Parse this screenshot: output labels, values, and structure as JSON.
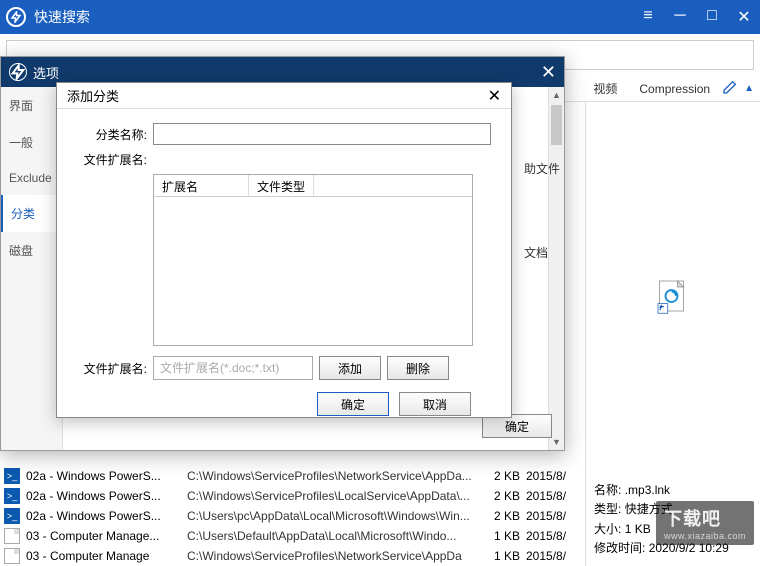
{
  "main": {
    "title": "快速搜索",
    "search_placeholder": "",
    "filetype_tabs": {
      "video": "视频",
      "compression": "Compression"
    },
    "confirm_btn": "确定"
  },
  "options_dialog": {
    "title": "选项",
    "nav": {
      "interface": "界面",
      "general": "一般",
      "exclude": "Exclude",
      "category": "分类",
      "disk": "磁盘"
    },
    "behind_fragments": {
      "help_file": "助文件",
      "doc": "文档"
    }
  },
  "add_category_modal": {
    "title": "添加分类",
    "name_label": "分类名称:",
    "ext_label": "文件扩展名:",
    "table": {
      "col_ext": "扩展名",
      "col_type": "文件类型"
    },
    "ext_input_label": "文件扩展名:",
    "ext_input_placeholder": "文件扩展名(*.doc;*.txt)",
    "add_btn": "添加",
    "delete_btn": "删除",
    "ok_btn": "确定",
    "cancel_btn": "取消"
  },
  "preview": {
    "name_label": "名称:",
    "name_value": ".mp3.lnk",
    "type_label": "类型:",
    "type_value": "快捷方式",
    "size_label": "大小:",
    "size_value": "1 KB",
    "mtime_label": "修改时间:",
    "mtime_value": "2020/9/2 10:29"
  },
  "files": [
    {
      "icon": "ps",
      "name": "02a - Windows PowerS...",
      "path": "C:\\Windows\\ServiceProfiles\\NetworkService\\AppDa...",
      "size": "2 KB",
      "date": "2015/8/"
    },
    {
      "icon": "ps",
      "name": "02a - Windows PowerS...",
      "path": "C:\\Windows\\ServiceProfiles\\LocalService\\AppData\\...",
      "size": "2 KB",
      "date": "2015/8/"
    },
    {
      "icon": "ps",
      "name": "02a - Windows PowerS...",
      "path": "C:\\Users\\pc\\AppData\\Local\\Microsoft\\Windows\\Win...",
      "size": "2 KB",
      "date": "2015/8/"
    },
    {
      "icon": "doc",
      "name": "03 - Computer Manage...",
      "path": "C:\\Users\\Default\\AppData\\Local\\Microsoft\\Windo...",
      "size": "1 KB",
      "date": "2015/8/"
    },
    {
      "icon": "doc",
      "name": "03 - Computer Manage",
      "path": "C:\\Windows\\ServiceProfiles\\NetworkService\\AppDa",
      "size": "1 KB",
      "date": "2015/8/"
    }
  ],
  "watermark": {
    "main": "下载吧",
    "sub": "www.xiazaiba.com"
  }
}
